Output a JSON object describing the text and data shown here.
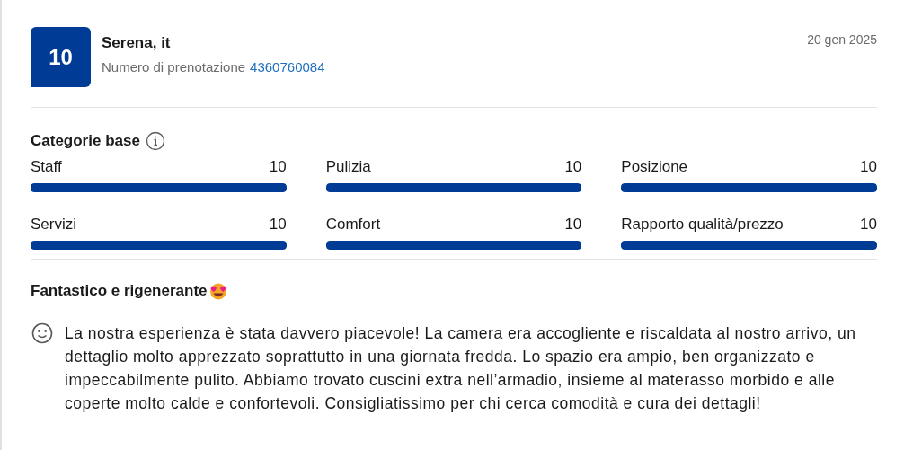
{
  "review": {
    "score": "10",
    "reviewer": "Serena, it",
    "booking_label": "Numero di prenotazione",
    "booking_number": "4360760084",
    "date": "20 gen 2025"
  },
  "categories": {
    "title": "Categorie base",
    "items": [
      {
        "name": "Staff",
        "score": "10",
        "level": 1
      },
      {
        "name": "Pulizia",
        "score": "10",
        "level": 1
      },
      {
        "name": "Posizione",
        "score": "10",
        "level": 1
      },
      {
        "name": "Servizi",
        "score": "10",
        "level": 1
      },
      {
        "name": "Comfort",
        "score": "10",
        "level": 1
      },
      {
        "name": "Rapporto qualità/prezzo",
        "score": "10",
        "level": 1
      }
    ]
  },
  "comment": {
    "title": "Fantastico e rigenerante",
    "text": "La nostra esperienza è stata davvero piacevole! La camera era accogliente e riscaldata al nostro arrivo, un dettaglio molto apprezzato soprattutto in una giornata fredda. Lo spazio era ampio, ben organizzato e impeccabilmente pulito. Abbiamo trovato cuscini extra nell’armadio, insieme al materasso morbido e alle coperte molto calde e confortevoli. Consigliatissimo per chi cerca comodità e cura dei dettagli!"
  }
}
